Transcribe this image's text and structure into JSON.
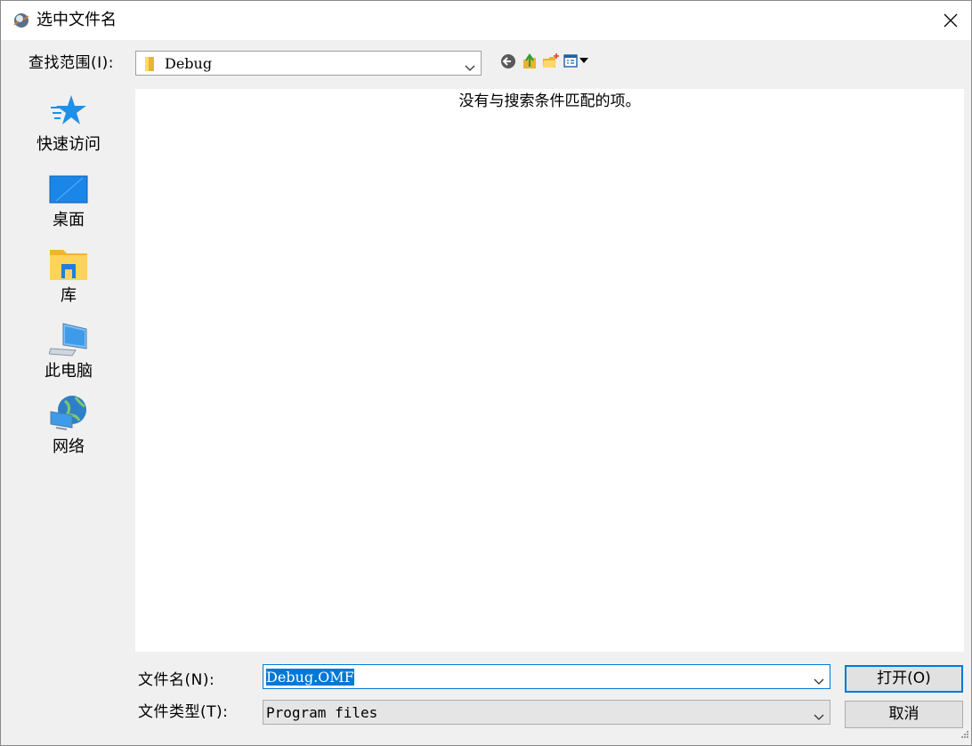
{
  "window": {
    "title": "选中文件名"
  },
  "lookin": {
    "label": "查找范围(I):",
    "value": "Debug"
  },
  "toolbar": {
    "buttons": [
      {
        "name": "back",
        "icon": "back-arrow-icon"
      },
      {
        "name": "up-folder",
        "icon": "up-folder-icon"
      },
      {
        "name": "new-folder",
        "icon": "new-folder-icon"
      },
      {
        "name": "view-menu",
        "icon": "view-menu-icon"
      }
    ]
  },
  "places": [
    {
      "label": "快速访问",
      "icon": "quick-access-star-icon"
    },
    {
      "label": "桌面",
      "icon": "desktop-icon"
    },
    {
      "label": "库",
      "icon": "libraries-folder-icon"
    },
    {
      "label": "此电脑",
      "icon": "this-pc-icon"
    },
    {
      "label": "网络",
      "icon": "network-globe-icon"
    }
  ],
  "filelist": {
    "empty_message": "没有与搜索条件匹配的项。"
  },
  "filename": {
    "label": "文件名(N):",
    "value": "Debug.OMF"
  },
  "filetype": {
    "label": "文件类型(T):",
    "value": "Program files"
  },
  "buttons": {
    "open": "打开(O)",
    "cancel": "取消"
  },
  "colors": {
    "accent": "#0078d7",
    "folder": "#ffc83d"
  }
}
